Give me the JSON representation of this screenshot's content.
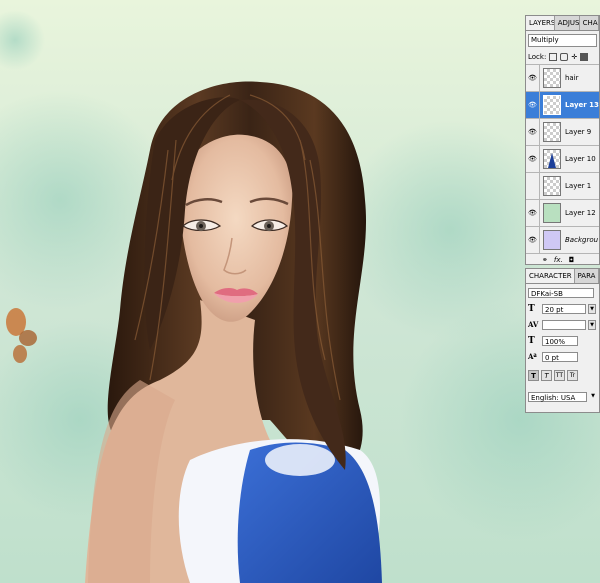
{
  "layers_panel": {
    "tabs": [
      "LAYERS",
      "ADJUS",
      "CHA"
    ],
    "blend_mode": "Multiply",
    "lock_label": "Lock:",
    "layers": [
      {
        "name": "hair",
        "visible": true,
        "selected": false
      },
      {
        "name": "Layer 13",
        "visible": true,
        "selected": true
      },
      {
        "name": "Layer 9",
        "visible": true,
        "selected": false
      },
      {
        "name": "Layer 10",
        "visible": true,
        "selected": false
      },
      {
        "name": "Layer 1",
        "visible": false,
        "selected": false
      },
      {
        "name": "Layer 12",
        "visible": true,
        "selected": false
      },
      {
        "name": "Backgrou",
        "visible": true,
        "selected": false
      }
    ]
  },
  "character_panel": {
    "tabs": [
      "CHARACTER",
      "PARA"
    ],
    "font_family": "DFKai-SB",
    "font_size": "20 pt",
    "vertical_scale": "100%",
    "baseline_shift": "0 pt",
    "language": "English: USA",
    "style_buttons": [
      "T",
      "T",
      "TT",
      "Tr"
    ]
  },
  "colors": {
    "background": "#cfe7d6",
    "hair": "#3a2416",
    "skin": "#e6c1a6",
    "dress": "#2a5cc0",
    "selected_layer": "#3b7ed8"
  }
}
